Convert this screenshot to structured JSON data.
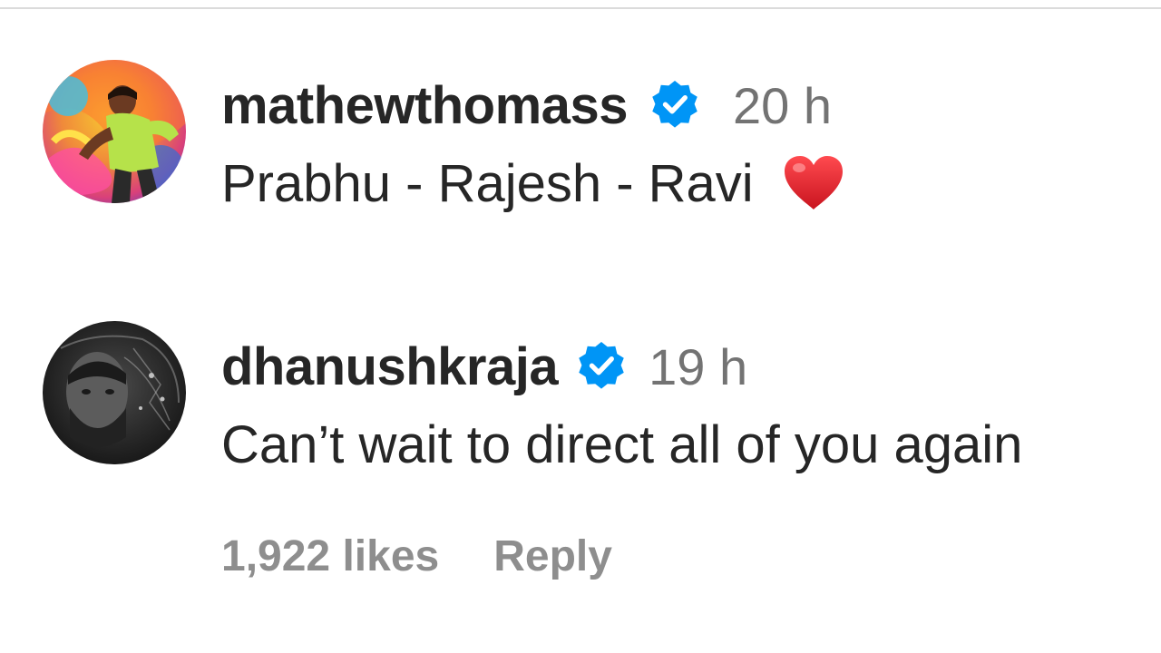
{
  "comments": [
    {
      "username": "mathewthomass",
      "verified": true,
      "time": "20 h",
      "text": "Prabhu - Rajesh - Ravi",
      "emoji_icon": "red-heart-icon",
      "avatar_icon": "profile-photo-colorful"
    },
    {
      "username": "dhanushkraja",
      "verified": true,
      "time": "19 h",
      "text": "Can’t wait to direct all of you again",
      "avatar_icon": "profile-photo-monochrome",
      "likes": "1,922 likes",
      "reply_label": "Reply"
    }
  ],
  "colors": {
    "username": "#262626",
    "meta": "#737373",
    "verified_blue": "#0095f6",
    "heart_red": "#e0242f",
    "divider": "#dbdbdb"
  }
}
